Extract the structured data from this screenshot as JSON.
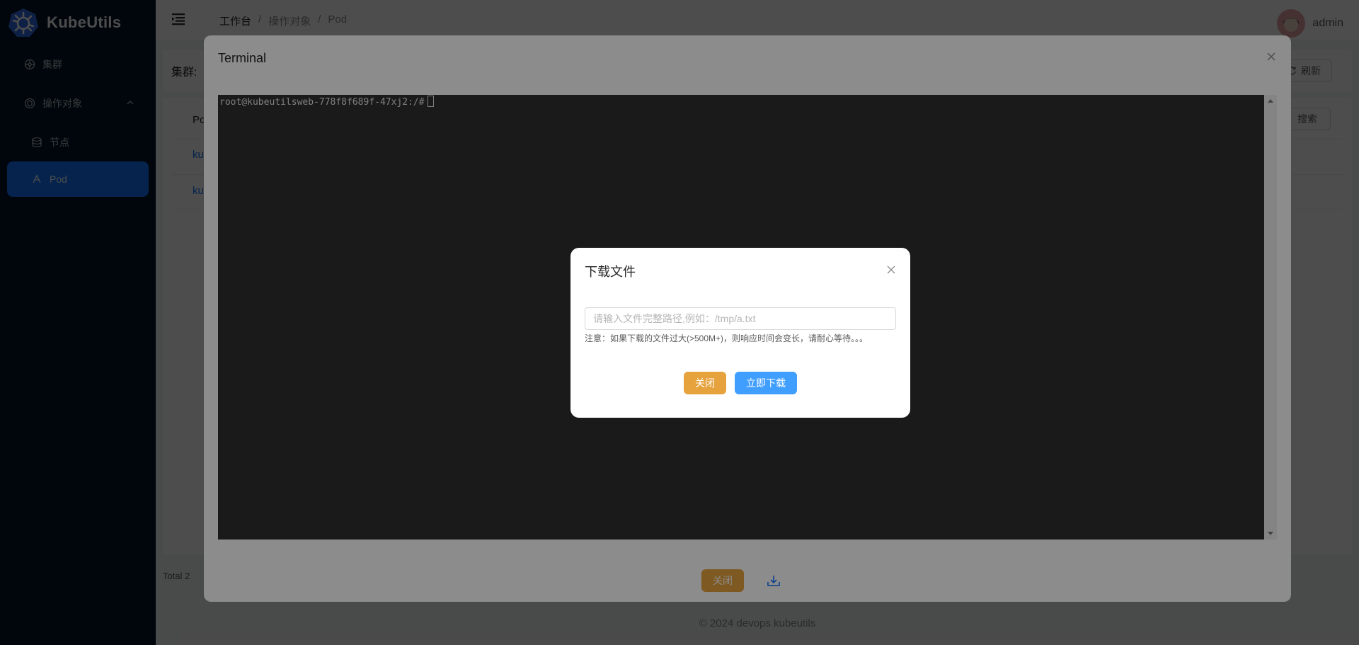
{
  "app": {
    "name": "KubeUtils"
  },
  "sidebar": {
    "items": [
      {
        "label": "集群",
        "icon": "cluster-icon"
      },
      {
        "label": "操作对象",
        "icon": "object-icon",
        "expanded": true
      },
      {
        "label": "节点",
        "icon": "node-icon"
      },
      {
        "label": "Pod",
        "icon": "pod-icon",
        "active": true
      }
    ]
  },
  "header": {
    "breadcrumb": [
      "工作台",
      "操作对象",
      "Pod"
    ],
    "user": "admin"
  },
  "background": {
    "filter_label": "集群:",
    "refresh_label": "刷新",
    "search_label": "搜索",
    "column_partial": "Po",
    "rows_partial": [
      "ku",
      "ku"
    ],
    "total": "Total 2",
    "footer": "2024 devops kubeutils"
  },
  "terminal": {
    "title": "Terminal",
    "prompt": "root@kubeutilsweb-778f8f689f-47xj2:/#",
    "close_label": "关闭"
  },
  "download_dialog": {
    "title": "下载文件",
    "input_value": "",
    "input_placeholder": "请输入文件完整路径,例如：/tmp/a.txt",
    "note": "注意：如果下载的文件过大(>500M+)，则响应时间会变长，请耐心等待。。。",
    "close_label": "关闭",
    "download_label": "立即下载"
  },
  "colors": {
    "sidebar_bg": "#001529",
    "primary": "#1677ff",
    "warning": "#e6a23c",
    "info": "#409eff",
    "terminal_bg": "#303030"
  }
}
